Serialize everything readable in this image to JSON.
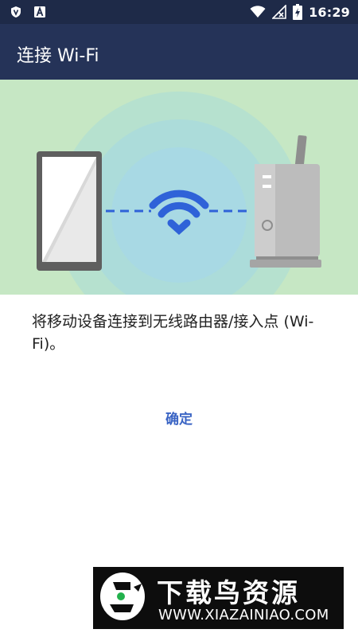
{
  "status_bar": {
    "time": "16:29",
    "left_icons": [
      "shield-icon",
      "text-a-icon"
    ],
    "right_icons": [
      "wifi-icon",
      "no-signal-icon",
      "battery-charging-icon"
    ]
  },
  "app_bar": {
    "title": "连接 Wi-Fi"
  },
  "illustration": {
    "background": "#c6e7c4",
    "accent": "#2f62d8",
    "icons": [
      "phone-icon",
      "wifi-icon",
      "router-icon"
    ]
  },
  "content": {
    "description": "将移动设备连接到无线路由器/接入点 (Wi-Fi)。"
  },
  "actions": {
    "ok_label": "确定"
  },
  "watermark": {
    "title": "下载鸟资源",
    "url": "WWW.XIAZAINIAO.COM"
  },
  "colors": {
    "status_bar": "#1e2a48",
    "app_bar": "#253358",
    "button_text": "#3a64c4"
  }
}
